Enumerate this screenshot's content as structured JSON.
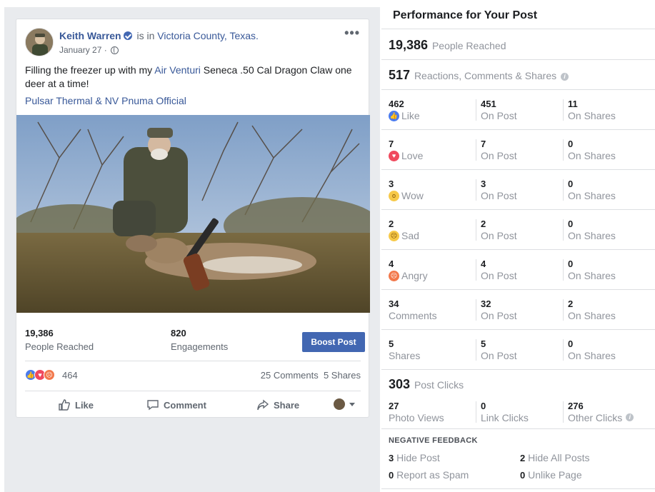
{
  "post": {
    "author": "Keith Warren",
    "is_in": "is in",
    "location": "Victoria County, Texas.",
    "date": "January 27 ·",
    "text_part1": "Filling the freezer up with my ",
    "text_link": "Air Venturi",
    "text_part2": " Seneca .50 Cal Dragon Claw one deer at a time!",
    "tag_line": "Pulsar Thermal & NV Pnuma Official",
    "more_label": "•••",
    "people_reached": "19,386",
    "people_reached_label": "People Reached",
    "engagements": "820",
    "engagements_label": "Engagements",
    "boost_label": "Boost Post",
    "reaction_count": "464",
    "comments_count": "25 Comments",
    "shares_count": "5 Shares",
    "action_like": "Like",
    "action_comment": "Comment",
    "action_share": "Share"
  },
  "performance": {
    "title": "Performance for Your Post",
    "reached_num": "19,386",
    "reached_label": "People Reached",
    "rcs_num": "517",
    "rcs_label": "Reactions, Comments & Shares",
    "rows": [
      {
        "total": "462",
        "label": "Like",
        "on_post": "451",
        "on_post_label": "On Post",
        "on_shares": "11",
        "on_shares_label": "On Shares"
      },
      {
        "total": "7",
        "label": "Love",
        "on_post": "7",
        "on_post_label": "On Post",
        "on_shares": "0",
        "on_shares_label": "On Shares"
      },
      {
        "total": "3",
        "label": "Wow",
        "on_post": "3",
        "on_post_label": "On Post",
        "on_shares": "0",
        "on_shares_label": "On Shares"
      },
      {
        "total": "2",
        "label": "Sad",
        "on_post": "2",
        "on_post_label": "On Post",
        "on_shares": "0",
        "on_shares_label": "On Shares"
      },
      {
        "total": "4",
        "label": "Angry",
        "on_post": "4",
        "on_post_label": "On Post",
        "on_shares": "0",
        "on_shares_label": "On Shares"
      },
      {
        "total": "34",
        "label": "Comments",
        "on_post": "32",
        "on_post_label": "On Post",
        "on_shares": "2",
        "on_shares_label": "On Shares"
      },
      {
        "total": "5",
        "label": "Shares",
        "on_post": "5",
        "on_post_label": "On Post",
        "on_shares": "0",
        "on_shares_label": "On Shares"
      }
    ],
    "clicks_num": "303",
    "clicks_label": "Post Clicks",
    "photo_views": "27",
    "photo_views_label": "Photo Views",
    "link_clicks": "0",
    "link_clicks_label": "Link Clicks",
    "other_clicks": "276",
    "other_clicks_label": "Other Clicks",
    "negative_title": "NEGATIVE FEEDBACK",
    "hide_post_num": "3",
    "hide_post_label": "Hide Post",
    "hide_all_num": "2",
    "hide_all_label": "Hide All Posts",
    "spam_num": "0",
    "spam_label": "Report as Spam",
    "unlike_num": "0",
    "unlike_label": "Unlike Page"
  },
  "colors": {
    "fb_blue": "#4267b2",
    "link": "#385898",
    "muted": "#90949c"
  },
  "icons": [
    "verified-badge-icon",
    "globe-icon",
    "more-icon",
    "like-icon",
    "comment-icon",
    "share-icon",
    "caret-down-icon",
    "info-icon"
  ]
}
